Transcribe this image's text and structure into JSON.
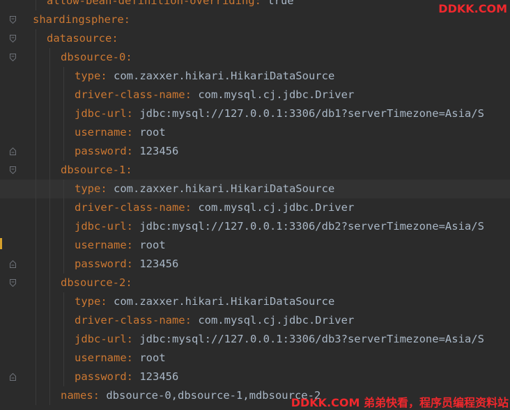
{
  "lines": [
    {
      "key": "allow-bean-definition-overriding",
      "value": "true",
      "indent": 1,
      "fold": "none"
    },
    {
      "key": "shardingsphere",
      "value": "",
      "indent": 0,
      "fold": "open"
    },
    {
      "key": "datasource",
      "value": "",
      "indent": 1,
      "fold": "open"
    },
    {
      "key": "dbsource-0",
      "value": "",
      "indent": 2,
      "fold": "open"
    },
    {
      "key": "type",
      "value": "com.zaxxer.hikari.HikariDataSource",
      "indent": 3,
      "fold": "none"
    },
    {
      "key": "driver-class-name",
      "value": "com.mysql.cj.jdbc.Driver",
      "indent": 3,
      "fold": "none"
    },
    {
      "key": "jdbc-url",
      "value": "jdbc:mysql://127.0.0.1:3306/db1?serverTimezone=Asia/S",
      "indent": 3,
      "fold": "none"
    },
    {
      "key": "username",
      "value": "root",
      "indent": 3,
      "fold": "none"
    },
    {
      "key": "password",
      "value": "123456",
      "indent": 3,
      "fold": "close"
    },
    {
      "key": "dbsource-1",
      "value": "",
      "indent": 2,
      "fold": "open"
    },
    {
      "key": "type",
      "value": "com.zaxxer.hikari.HikariDataSource",
      "indent": 3,
      "fold": "none"
    },
    {
      "key": "driver-class-name",
      "value": "com.mysql.cj.jdbc.Driver",
      "indent": 3,
      "fold": "none"
    },
    {
      "key": "jdbc-url",
      "value": "jdbc:mysql://127.0.0.1:3306/db2?serverTimezone=Asia/S",
      "indent": 3,
      "fold": "none"
    },
    {
      "key": "username",
      "value": "root",
      "indent": 3,
      "fold": "none"
    },
    {
      "key": "password",
      "value": "123456",
      "indent": 3,
      "fold": "close"
    },
    {
      "key": "dbsource-2",
      "value": "",
      "indent": 2,
      "fold": "open"
    },
    {
      "key": "type",
      "value": "com.zaxxer.hikari.HikariDataSource",
      "indent": 3,
      "fold": "none"
    },
    {
      "key": "driver-class-name",
      "value": "com.mysql.cj.jdbc.Driver",
      "indent": 3,
      "fold": "none"
    },
    {
      "key": "jdbc-url",
      "value": "jdbc:mysql://127.0.0.1:3306/db3?serverTimezone=Asia/S",
      "indent": 3,
      "fold": "none"
    },
    {
      "key": "username",
      "value": "root",
      "indent": 3,
      "fold": "none"
    },
    {
      "key": "password",
      "value": "123456",
      "indent": 3,
      "fold": "close"
    },
    {
      "key": "names",
      "value": "dbsource-0,dbsource-1,mdbsource-2",
      "indent": 2,
      "fold": "none"
    }
  ],
  "watermark_top": "DDKK.COM",
  "watermark_bottom": "DDKK.COM 弟弟快看，程序员编程资料站",
  "colors": {
    "background": "#2b2b2b",
    "key": "#cc7832",
    "value": "#a9b7c6",
    "watermark": "#f0282d",
    "current_line": "#323232"
  }
}
